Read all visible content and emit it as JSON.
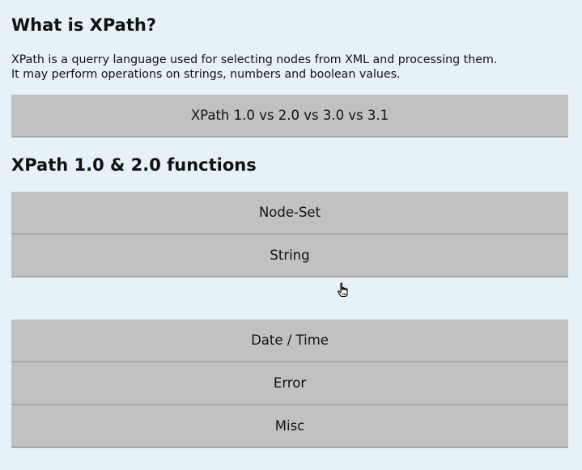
{
  "headings": {
    "what_is": "What is XPath?",
    "functions": "XPath 1.0 & 2.0 functions"
  },
  "intro": {
    "line1": "XPath is a querry language used for selecting nodes from XML and processing them.",
    "line2": "It may perform operations on strings, numbers and boolean values."
  },
  "versions_button": "XPath 1.0 vs 2.0 vs 3.0 vs 3.1",
  "function_groups": [
    "Node-Set",
    "String",
    "Date / Time",
    "Error",
    "Misc"
  ],
  "colors": {
    "page_background": "#e6f2f8",
    "button_background": "#c1c1c3",
    "button_border": "#a8a8aa"
  },
  "cursor_icon": "hand-pointer-icon"
}
